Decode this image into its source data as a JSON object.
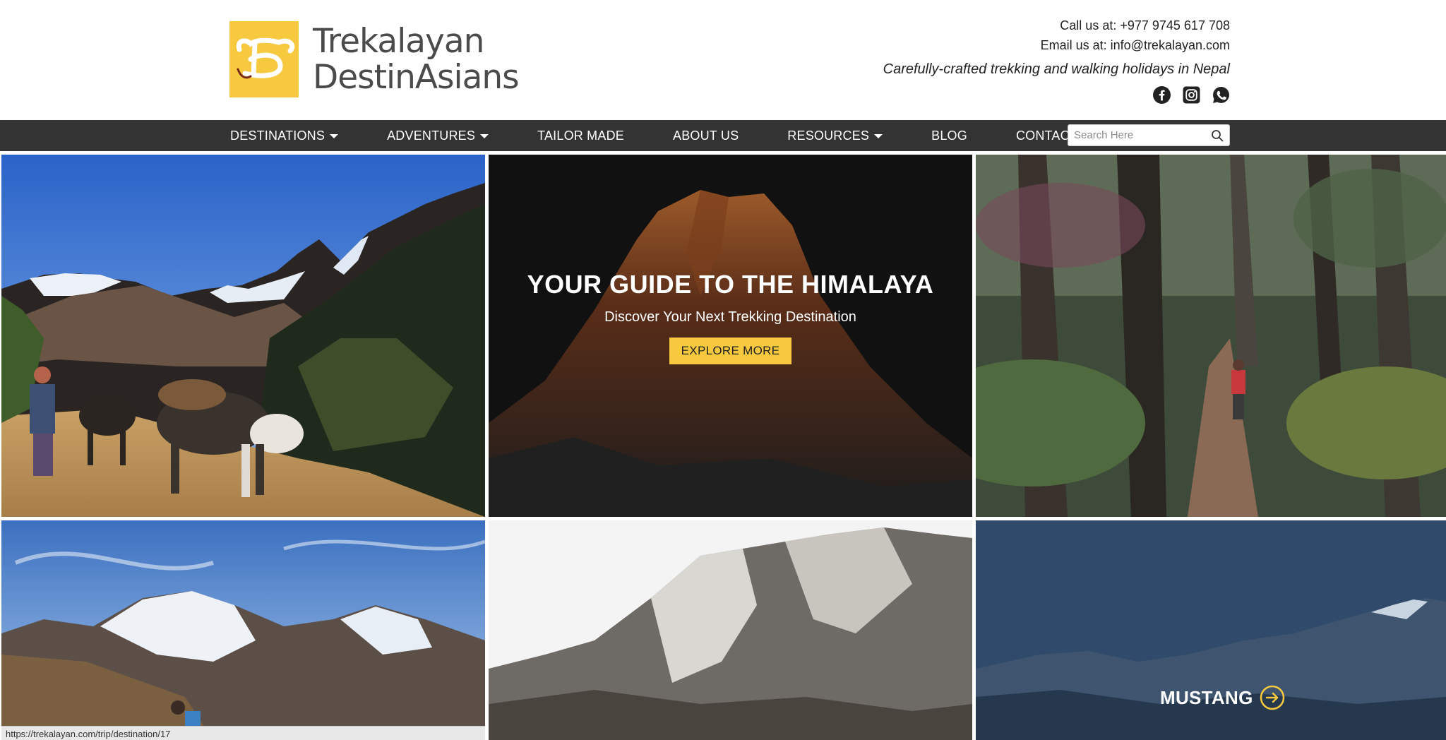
{
  "header": {
    "logo_line1": "Trekalayan",
    "logo_line2": "DestinAsians",
    "call": "Call us at: +977 9745 617 708",
    "email": "Email us at: info@trekalayan.com",
    "tagline": "Carefully-crafted trekking and walking holidays in Nepal",
    "social": [
      {
        "icon": "facebook-icon"
      },
      {
        "icon": "instagram-icon"
      },
      {
        "icon": "whatsapp-icon"
      }
    ]
  },
  "nav": {
    "items": [
      {
        "label": "DESTINATIONS",
        "dropdown": true
      },
      {
        "label": "ADVENTURES",
        "dropdown": true
      },
      {
        "label": "TAILOR MADE",
        "dropdown": false
      },
      {
        "label": "ABOUT US",
        "dropdown": false
      },
      {
        "label": "RESOURCES",
        "dropdown": true
      },
      {
        "label": "BLOG",
        "dropdown": false
      },
      {
        "label": "CONTACT",
        "dropdown": false
      }
    ],
    "search_placeholder": "Search Here"
  },
  "hero": {
    "title": "YOUR GUIDE TO THE HIMALAYA",
    "subtitle": "Discover Your Next Trekking Destination",
    "button": "EXPLORE MORE"
  },
  "tiles": {
    "mustang_label": "MUSTANG"
  },
  "status_bar": {
    "url": "https://trekalayan.com/trip/destination/17"
  },
  "colors": {
    "accent": "#f6c93f",
    "nav_bg": "#333333",
    "text": "#222222"
  }
}
